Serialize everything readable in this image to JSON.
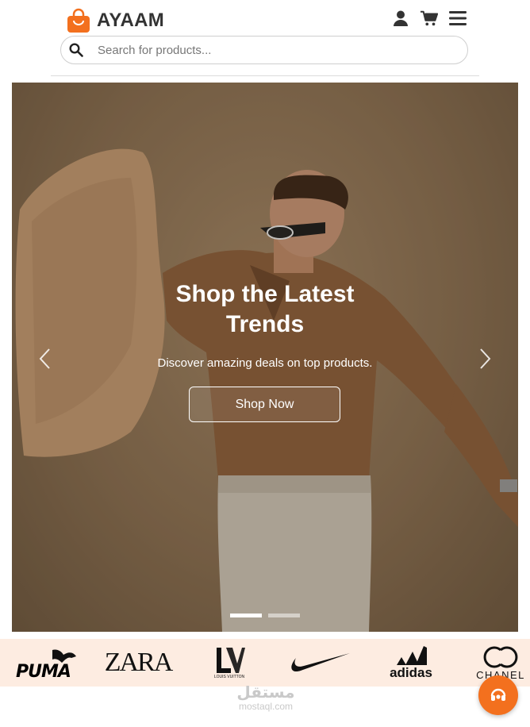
{
  "brand": {
    "name": "AYAAM",
    "accent": "#f3701e"
  },
  "header": {
    "icons": [
      "user-icon",
      "cart-icon",
      "menu-icon"
    ]
  },
  "search": {
    "placeholder": "Search for products...",
    "value": ""
  },
  "hero": {
    "title": "Shop the Latest Trends",
    "subtitle": "Discover amazing deals on top products.",
    "cta": "Shop Now",
    "slides_total": 2,
    "active_slide": 1
  },
  "brands": [
    {
      "name": "puma-logo",
      "text": "PUMA"
    },
    {
      "name": "zara-logo",
      "text": "ZARA"
    },
    {
      "name": "louis-vuitton-logo",
      "text": "LOUIS VUITTON"
    },
    {
      "name": "nike-logo",
      "text": ""
    },
    {
      "name": "adidas-logo",
      "text": "adidas"
    },
    {
      "name": "chanel-logo",
      "text": "CHANEL"
    }
  ],
  "watermark": {
    "arabic": "مستقل",
    "latin": "mostaql.com"
  },
  "colors": {
    "strip_bg": "#fdece1",
    "fab_bg": "#f3701e",
    "text_dark": "#333333"
  }
}
